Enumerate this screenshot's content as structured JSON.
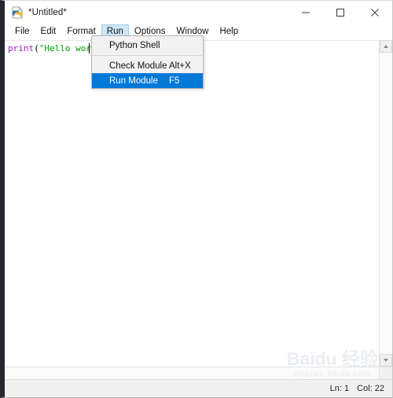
{
  "window": {
    "title": "*Untitled*",
    "icon": "python-idle-icon",
    "controls": {
      "minimize": "minimize-icon",
      "maximize": "maximize-icon",
      "close": "close-icon"
    }
  },
  "menubar": {
    "items": [
      {
        "label": "File",
        "active": false
      },
      {
        "label": "Edit",
        "active": false
      },
      {
        "label": "Format",
        "active": false
      },
      {
        "label": "Run",
        "active": true
      },
      {
        "label": "Options",
        "active": false
      },
      {
        "label": "Window",
        "active": false
      },
      {
        "label": "Help",
        "active": false
      }
    ]
  },
  "run_menu": {
    "items": [
      {
        "label": "Python Shell",
        "accel": "",
        "selected": false
      },
      {
        "label": "Check Module",
        "accel": "Alt+X",
        "selected": false
      },
      {
        "label": "Run Module",
        "accel": "F5",
        "selected": true
      }
    ]
  },
  "editor": {
    "code": {
      "func": "print",
      "paren": "(",
      "string": "\"Hello worl"
    },
    "full_visible_text": "print(\"Hello worl"
  },
  "scrollbars": {
    "vertical_up": "scroll-up-arrow-icon",
    "vertical_down": "scroll-down-arrow-icon"
  },
  "status_bar": {
    "line": "Ln: 1",
    "column": "Col: 22"
  },
  "watermark": {
    "main": "Baidu 经验",
    "sub": "jingyan.baidu.com"
  },
  "colors": {
    "menu_highlight": "#cfe8f7",
    "dropdown_selected": "#0078d7",
    "keyword": "#a020c0",
    "string": "#00a000",
    "status_bg": "#f0f0f0"
  }
}
